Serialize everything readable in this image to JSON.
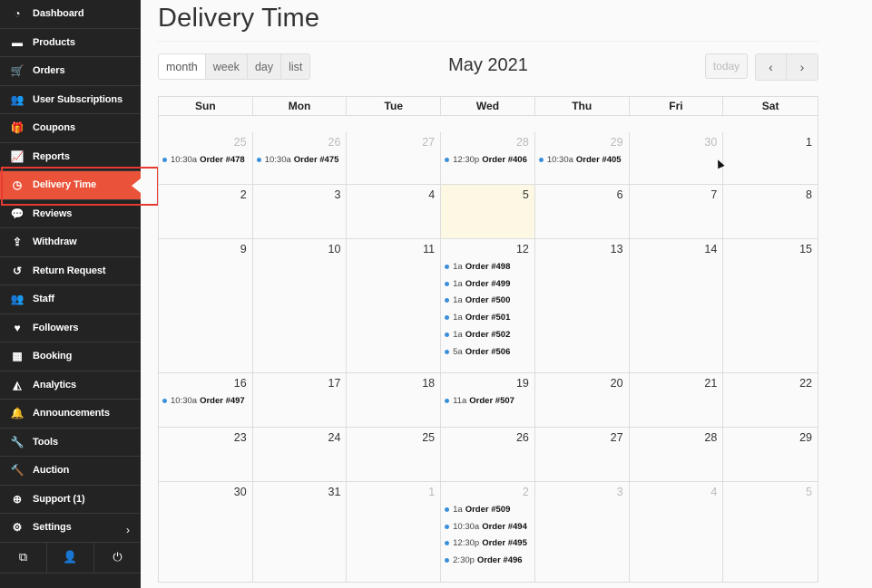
{
  "sidebar": {
    "items": [
      {
        "label": "Dashboard",
        "icon": "dashboard-icon",
        "glyph": "◔"
      },
      {
        "label": "Products",
        "icon": "briefcase-icon",
        "glyph": "▬"
      },
      {
        "label": "Orders",
        "icon": "cart-icon",
        "glyph": "🛒"
      },
      {
        "label": "User Subscriptions",
        "icon": "users-icon",
        "glyph": "👥"
      },
      {
        "label": "Coupons",
        "icon": "gift-icon",
        "glyph": "🎁"
      },
      {
        "label": "Reports",
        "icon": "line-chart-icon",
        "glyph": "📈"
      },
      {
        "label": "Delivery Time",
        "icon": "clock-icon",
        "glyph": "◷",
        "active": true
      },
      {
        "label": "Reviews",
        "icon": "comments-icon",
        "glyph": "💬"
      },
      {
        "label": "Withdraw",
        "icon": "upload-icon",
        "glyph": "⇪"
      },
      {
        "label": "Return Request",
        "icon": "undo-icon",
        "glyph": "↺"
      },
      {
        "label": "Staff",
        "icon": "users-icon",
        "glyph": "👥"
      },
      {
        "label": "Followers",
        "icon": "heart-icon",
        "glyph": "♥"
      },
      {
        "label": "Booking",
        "icon": "calendar-icon",
        "glyph": "▦"
      },
      {
        "label": "Analytics",
        "icon": "area-chart-icon",
        "glyph": "◭"
      },
      {
        "label": "Announcements",
        "icon": "bell-icon",
        "glyph": "🔔"
      },
      {
        "label": "Tools",
        "icon": "wrench-icon",
        "glyph": "🔧"
      },
      {
        "label": "Auction",
        "icon": "gavel-icon",
        "glyph": "🔨"
      },
      {
        "label": "Support (1)",
        "icon": "life-ring-icon",
        "glyph": "⊕"
      },
      {
        "label": "Settings",
        "icon": "gear-icon",
        "glyph": "⚙",
        "chevron": "›"
      }
    ],
    "footer": [
      {
        "icon": "external-link-icon",
        "glyph": "⧉"
      },
      {
        "icon": "user-icon",
        "glyph": "👤"
      },
      {
        "icon": "power-icon",
        "glyph": "⏻"
      }
    ]
  },
  "page": {
    "title": "Delivery Time"
  },
  "toolbar": {
    "views": [
      "month",
      "week",
      "day",
      "list"
    ],
    "active_view": "month",
    "calendar_title": "May 2021",
    "today_label": "today",
    "prev_glyph": "‹",
    "next_glyph": "›"
  },
  "calendar": {
    "days_of_week": [
      "Sun",
      "Mon",
      "Tue",
      "Wed",
      "Thu",
      "Fri",
      "Sat"
    ],
    "event_color": "#3b8fd9",
    "today_color": "#fcf8e3",
    "weeks": [
      [
        {
          "num": "25",
          "other": true,
          "events": [
            {
              "time": "10:30a",
              "title": "Order #478"
            }
          ]
        },
        {
          "num": "26",
          "other": true,
          "events": [
            {
              "time": "10:30a",
              "title": "Order #475"
            }
          ]
        },
        {
          "num": "27",
          "other": true,
          "events": []
        },
        {
          "num": "28",
          "other": true,
          "events": [
            {
              "time": "12:30p",
              "title": "Order #406"
            }
          ]
        },
        {
          "num": "29",
          "other": true,
          "events": [
            {
              "time": "10:30a",
              "title": "Order #405"
            }
          ]
        },
        {
          "num": "30",
          "other": true,
          "events": []
        },
        {
          "num": "1",
          "events": []
        }
      ],
      [
        {
          "num": "2",
          "events": []
        },
        {
          "num": "3",
          "events": []
        },
        {
          "num": "4",
          "events": []
        },
        {
          "num": "5",
          "today": true,
          "events": []
        },
        {
          "num": "6",
          "events": []
        },
        {
          "num": "7",
          "events": []
        },
        {
          "num": "8",
          "events": []
        }
      ],
      [
        {
          "num": "9",
          "events": []
        },
        {
          "num": "10",
          "events": []
        },
        {
          "num": "11",
          "events": []
        },
        {
          "num": "12",
          "events": [
            {
              "time": "1a",
              "title": "Order #498"
            },
            {
              "time": "1a",
              "title": "Order #499"
            },
            {
              "time": "1a",
              "title": "Order #500"
            },
            {
              "time": "1a",
              "title": "Order #501"
            },
            {
              "time": "1a",
              "title": "Order #502"
            },
            {
              "time": "5a",
              "title": "Order #506"
            }
          ]
        },
        {
          "num": "13",
          "events": []
        },
        {
          "num": "14",
          "events": []
        },
        {
          "num": "15",
          "events": []
        }
      ],
      [
        {
          "num": "16",
          "events": [
            {
              "time": "10:30a",
              "title": "Order #497"
            }
          ]
        },
        {
          "num": "17",
          "events": []
        },
        {
          "num": "18",
          "events": []
        },
        {
          "num": "19",
          "events": [
            {
              "time": "11a",
              "title": "Order #507"
            }
          ]
        },
        {
          "num": "20",
          "events": []
        },
        {
          "num": "21",
          "events": []
        },
        {
          "num": "22",
          "events": []
        }
      ],
      [
        {
          "num": "23",
          "events": []
        },
        {
          "num": "24",
          "events": []
        },
        {
          "num": "25",
          "events": []
        },
        {
          "num": "26",
          "events": []
        },
        {
          "num": "27",
          "events": []
        },
        {
          "num": "28",
          "events": []
        },
        {
          "num": "29",
          "events": []
        }
      ],
      [
        {
          "num": "30",
          "events": []
        },
        {
          "num": "31",
          "events": []
        },
        {
          "num": "1",
          "other": true,
          "events": []
        },
        {
          "num": "2",
          "other": true,
          "events": [
            {
              "time": "1a",
              "title": "Order #509"
            },
            {
              "time": "10:30a",
              "title": "Order #494"
            },
            {
              "time": "12:30p",
              "title": "Order #495"
            },
            {
              "time": "2:30p",
              "title": "Order #496"
            }
          ]
        },
        {
          "num": "3",
          "other": true,
          "events": []
        },
        {
          "num": "4",
          "other": true,
          "events": []
        },
        {
          "num": "5",
          "other": true,
          "events": []
        }
      ]
    ]
  }
}
